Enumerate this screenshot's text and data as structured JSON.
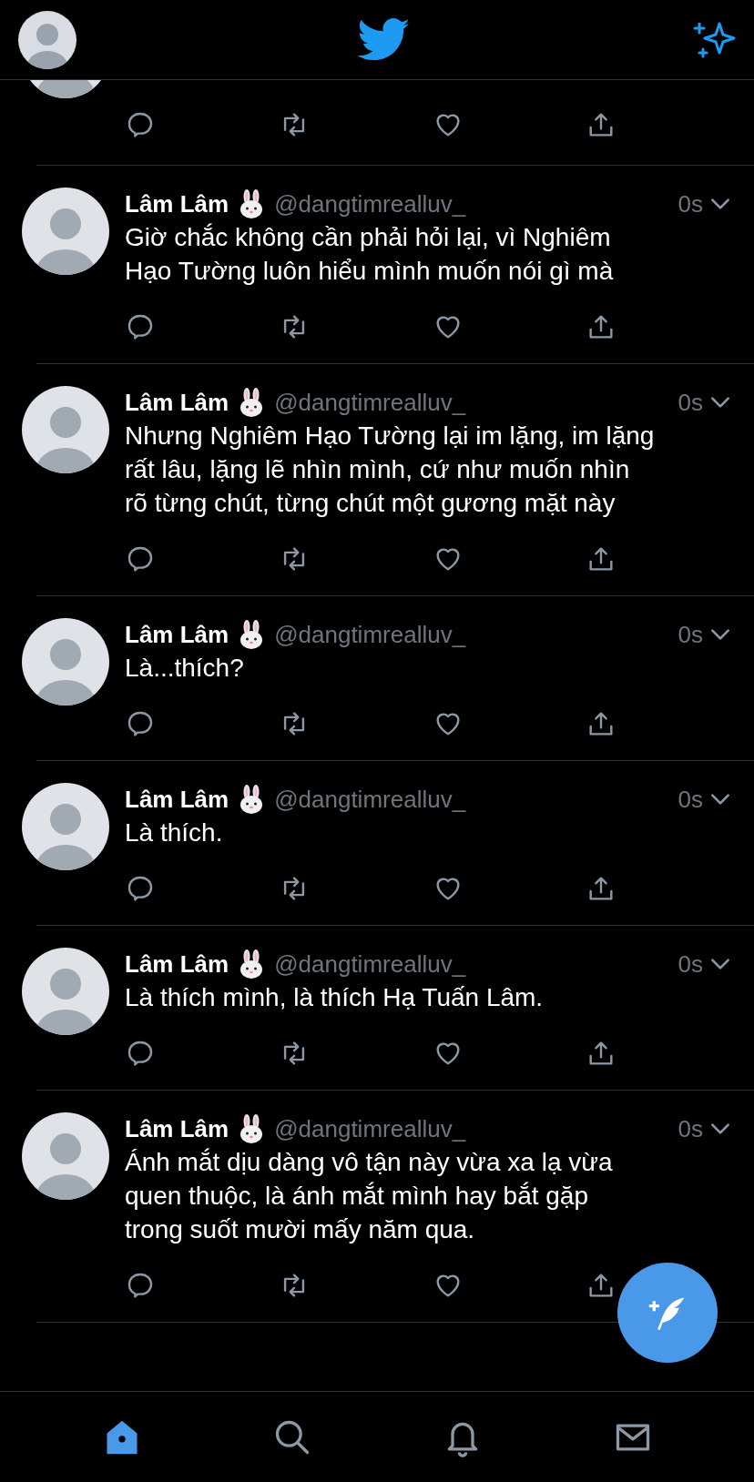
{
  "tweets": [
    {
      "kind": "fragment"
    },
    {
      "kind": "tweet",
      "name": "Lâm Lâm",
      "handle": "@dangtimrealluv_",
      "time": "0s",
      "lines": [
        "Giờ chắc không cần phải hỏi lại, vì Nghiêm",
        "Hạo Tường luôn hiểu mình muốn nói gì mà"
      ]
    },
    {
      "kind": "tweet",
      "name": "Lâm Lâm",
      "handle": "@dangtimrealluv_",
      "time": "0s",
      "lines": [
        "Nhưng Nghiêm Hạo Tường lại im lặng, im lặng",
        "rất lâu, lặng lẽ nhìn mình, cứ như muốn nhìn",
        "rõ từng chút, từng chút một gương mặt này"
      ]
    },
    {
      "kind": "tweet",
      "name": "Lâm Lâm",
      "handle": "@dangtimrealluv_",
      "time": "0s",
      "lines": [
        "Là...thích?"
      ]
    },
    {
      "kind": "tweet",
      "name": "Lâm Lâm",
      "handle": "@dangtimrealluv_",
      "time": "0s",
      "lines": [
        "Là thích."
      ]
    },
    {
      "kind": "tweet",
      "name": "Lâm Lâm",
      "handle": "@dangtimrealluv_",
      "time": "0s",
      "lines": [
        "Là thích mình, là thích Hạ Tuấn Lâm."
      ]
    },
    {
      "kind": "tweet",
      "name": "Lâm Lâm",
      "handle": "@dangtimrealluv_",
      "time": "0s",
      "lines": [
        "Ánh mắt dịu dàng vô tận này vừa xa lạ vừa",
        "quen thuộc, là ánh mắt mình hay bắt gặp",
        "trong suốt mười mấy năm qua."
      ]
    }
  ],
  "nav": [
    {
      "kind": "home",
      "selected": true
    },
    {
      "kind": "search",
      "selected": false
    },
    {
      "kind": "notifications",
      "selected": false
    },
    {
      "kind": "messages",
      "selected": false
    }
  ]
}
